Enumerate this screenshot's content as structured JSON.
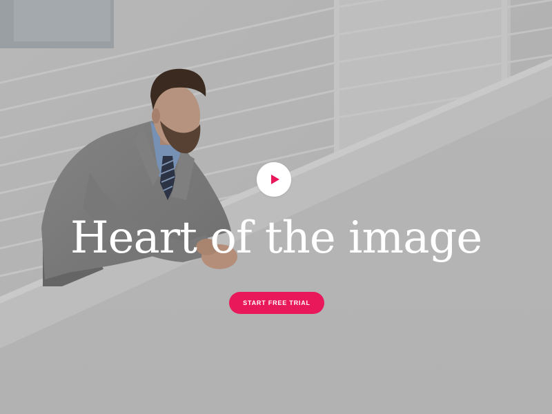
{
  "hero": {
    "headline": "Heart of the image",
    "cta_label": "START FREE TRIAL",
    "play_icon": "play-icon",
    "photo_subject": "businessman-leaning-on-railing"
  },
  "colors": {
    "accent": "#e8185b",
    "headline": "#ffffff",
    "play_button_bg": "#ffffff"
  }
}
